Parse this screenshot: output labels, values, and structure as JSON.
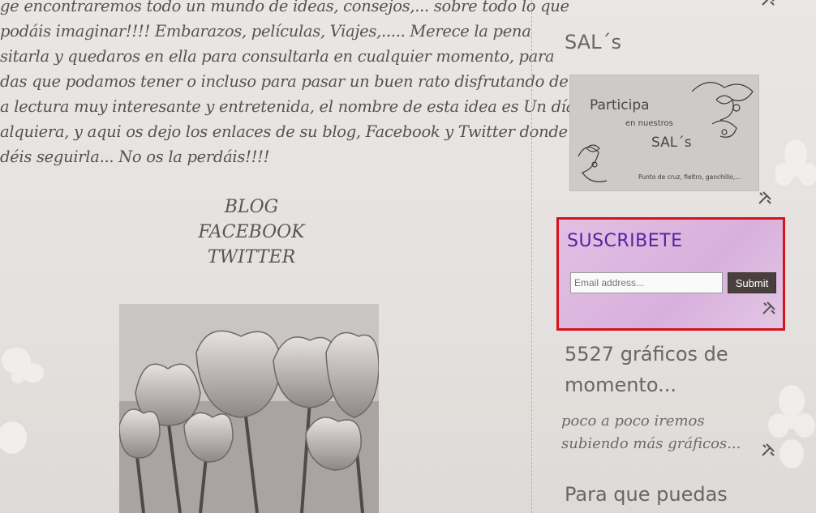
{
  "post": {
    "lines": [
      "ge encontraremos todo un mundo de ideas, consejos,... sobre todo lo que",
      "podáis imaginar!!!! Embarazos, películas, Viajes,..... Merece la pena",
      "sitarla y quedaros en ella para consultarla en cualquier momento, para",
      "das que podamos tener o incluso para pasar un buen rato disfrutando de",
      "a lectura muy interesante y entretenida, el nombre de esta idea es Un día",
      "alquiera, y aqui os dejo los enlaces de su blog, Facebook y Twitter donde",
      "déis seguirla... No os la perdáis!!!!"
    ],
    "links": [
      "BLOG",
      "FACEBOOK",
      "TWITTER"
    ]
  },
  "sidebar": {
    "sals_title": "SAL´s",
    "banner": {
      "participa": "Participa",
      "en_nuestros": "en nuestros",
      "sals": "SAL´s",
      "footer": "Punto de cruz, fieltro, ganchillo,..."
    },
    "subscribe": {
      "title": "SUSCRIBETE",
      "placeholder": "Email address...",
      "submit": "Submit"
    },
    "count_title": "5527 gráficos de momento...",
    "count_desc": "poco a poco iremos subiendo más gráficos...",
    "next_title": "Para que puedas"
  },
  "colors": {
    "highlight_border": "#d6121d",
    "subscribe_title": "#5a1fa0",
    "submit_bg": "#4a3f3f"
  },
  "icons": {
    "tools": "screwdriver-wrench-icon"
  }
}
